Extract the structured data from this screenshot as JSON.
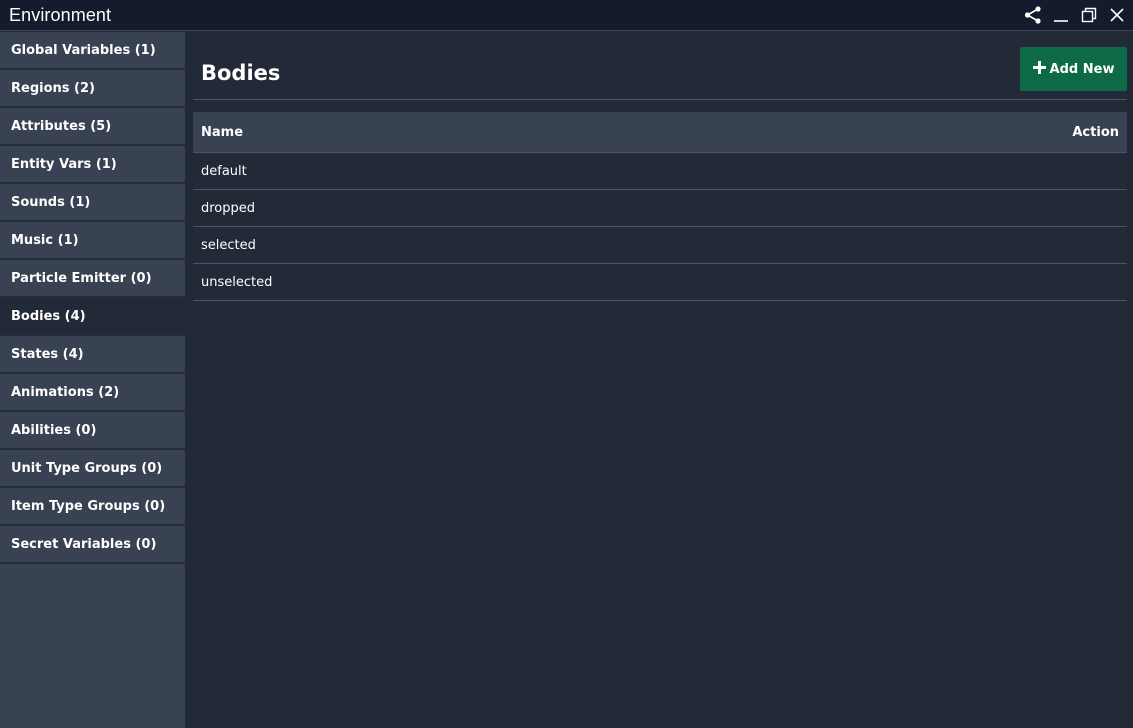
{
  "window": {
    "title": "Environment",
    "controls": [
      "share-icon",
      "minimize-icon",
      "restore-icon",
      "close-icon"
    ]
  },
  "sidebar": {
    "items": [
      {
        "label": "Global Variables (1)",
        "active": false
      },
      {
        "label": "Regions (2)",
        "active": false
      },
      {
        "label": "Attributes (5)",
        "active": false
      },
      {
        "label": "Entity Vars (1)",
        "active": false
      },
      {
        "label": "Sounds (1)",
        "active": false
      },
      {
        "label": "Music (1)",
        "active": false
      },
      {
        "label": "Particle Emitter (0)",
        "active": false
      },
      {
        "label": "Bodies (4)",
        "active": true
      },
      {
        "label": "States (4)",
        "active": false
      },
      {
        "label": "Animations (2)",
        "active": false
      },
      {
        "label": "Abilities (0)",
        "active": false
      },
      {
        "label": "Unit Type Groups (0)",
        "active": false
      },
      {
        "label": "Item Type Groups (0)",
        "active": false
      },
      {
        "label": "Secret Variables (0)",
        "active": false
      }
    ]
  },
  "main": {
    "title": "Bodies",
    "add_button": {
      "icon": "plus-icon",
      "label": "Add New",
      "color": "#0e6a46"
    },
    "table": {
      "columns": [
        "Name",
        "Action"
      ],
      "rows": [
        "default",
        "dropped",
        "selected",
        "unselected"
      ]
    }
  },
  "colors": {
    "titlebar": "#141b2c",
    "sidebar": "#394252",
    "main_bg": "#222937",
    "accent": "#0e6a46"
  }
}
